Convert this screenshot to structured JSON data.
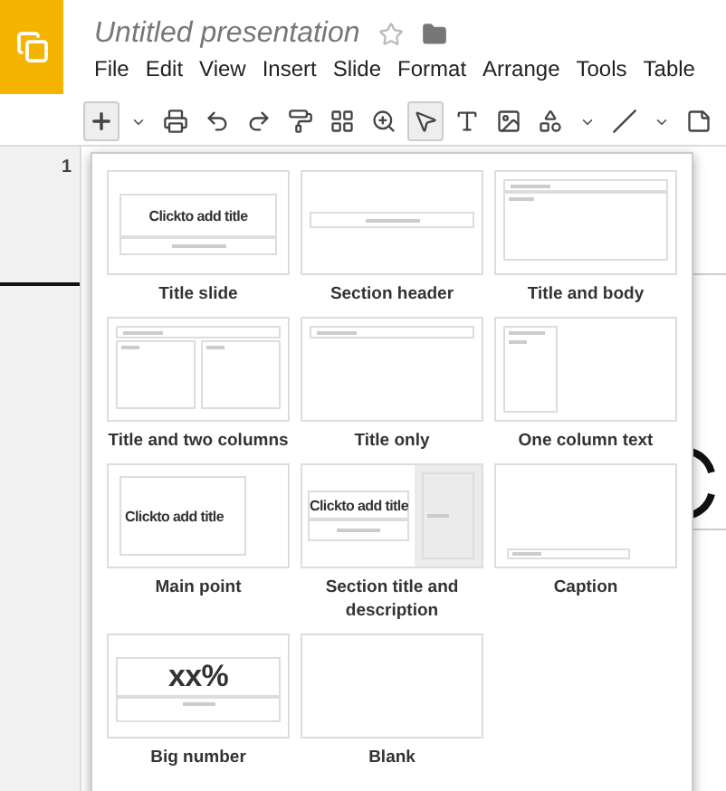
{
  "app": {
    "title": "Untitled presentation",
    "starred": false
  },
  "menu": [
    "File",
    "Edit",
    "View",
    "Insert",
    "Slide",
    "Format",
    "Arrange",
    "Tools",
    "Table"
  ],
  "toolbar": [
    {
      "kind": "add",
      "pressed": true
    },
    {
      "kind": "caret",
      "pressed": false
    },
    {
      "kind": "print",
      "pressed": false
    },
    {
      "kind": "undo",
      "pressed": false
    },
    {
      "kind": "redo",
      "pressed": false
    },
    {
      "kind": "paint",
      "pressed": false
    },
    {
      "kind": "layout",
      "pressed": false
    },
    {
      "kind": "zoom",
      "pressed": false
    },
    {
      "kind": "select",
      "pressed": true
    },
    {
      "kind": "textbox",
      "pressed": false
    },
    {
      "kind": "image",
      "pressed": false
    },
    {
      "kind": "shape",
      "pressed": false
    },
    {
      "kind": "caret",
      "pressed": false
    },
    {
      "kind": "line",
      "pressed": false
    },
    {
      "kind": "caret",
      "pressed": false
    },
    {
      "kind": "notes",
      "pressed": false
    }
  ],
  "filmstrip": {
    "slide_number": "1"
  },
  "layouts": [
    {
      "kind": "title_slide",
      "label": "Title slide",
      "title": "Clickto add title"
    },
    {
      "kind": "section_header",
      "label": "Section header"
    },
    {
      "kind": "title_body",
      "label": "Title and body"
    },
    {
      "kind": "two_columns",
      "label": "Title and two columns"
    },
    {
      "kind": "title_only",
      "label": "Title only"
    },
    {
      "kind": "one_column",
      "label": "One column text"
    },
    {
      "kind": "main_point",
      "label": "Main point",
      "title": "Clickto add title"
    },
    {
      "kind": "section_desc",
      "label": "Section title and description",
      "title": "Clickto add title"
    },
    {
      "kind": "caption",
      "label": "Caption"
    },
    {
      "kind": "big_number",
      "label": "Big number",
      "title": "xx%"
    },
    {
      "kind": "blank",
      "label": "Blank"
    }
  ]
}
